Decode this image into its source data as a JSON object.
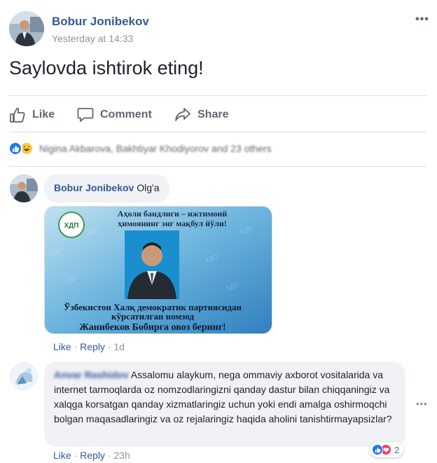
{
  "post": {
    "author": "Bobur Jonibekov",
    "timestamp": "Yesterday at 14:33",
    "text": "Saylovda ishtirok eting!",
    "more_label": "•••"
  },
  "actions": {
    "like_label": "Like",
    "comment_label": "Comment",
    "share_label": "Share"
  },
  "reactions_summary": {
    "names_text": "Nigina Akbarova, Bakhtiyar Khodiyorov and 23 others",
    "icons": [
      "like-icon",
      "haha-icon"
    ]
  },
  "comments": [
    {
      "author": "Bobur Jonibekov",
      "text": "Olg'a",
      "photo": {
        "banner_line1": "Аҳоли бандлиги – ижтимоий",
        "banner_line2": "ҳимоянинг энг мақбул йўли!",
        "caption_line1": "Ўзбекистон Халқ демократик партиясидан",
        "caption_line2": "кўрсатилган номзод",
        "caption_line3": "Жанибеков Бобирга овоз беринг!",
        "watermark": "ХДП"
      },
      "like_label": "Like",
      "reply_label": "Reply",
      "time": "1d"
    },
    {
      "author": "Anvar Rashidov",
      "text": "Assalomu alaykum, nega ommaviy axborot vositalarida va internet tarmoqlarda oz nomzodlaringizni qanday dastur bilan chiqqaningiz va xalqga korsatgan qanday xizmatlaringiz uchun yoki endi amalga oshirmoqchi bolgan maqasadlaringiz va oz rejalaringiz haqida aholini tanishtirmayapsizlar?",
      "like_label": "Like",
      "reply_label": "Reply",
      "time": "23h",
      "reaction_count": "2",
      "more_label": "•••"
    }
  ],
  "colors": {
    "link_blue": "#385898",
    "meta_gray": "#90949c",
    "bubble_bg": "#f0f2f5",
    "like_blue": "#1877f2",
    "love_red": "#f33e58",
    "haha_yellow": "#f7c940"
  }
}
